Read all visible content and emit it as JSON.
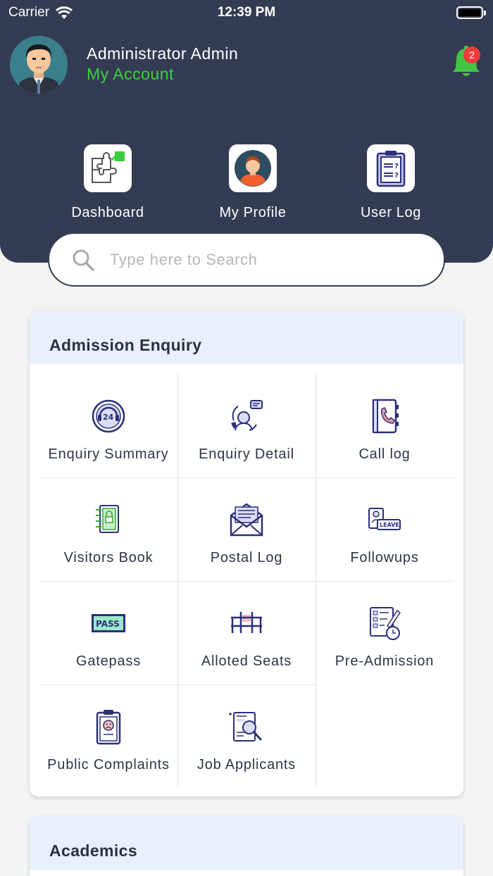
{
  "status_bar": {
    "carrier": "Carrier",
    "time": "12:39 PM"
  },
  "user": {
    "name": "Administrator Admin",
    "account_link": "My Account"
  },
  "notifications": {
    "count": "2",
    "icon": "bell-icon"
  },
  "quick_actions": [
    {
      "label": "Dashboard",
      "icon": "dashboard-puzzle-icon"
    },
    {
      "label": "My Profile",
      "icon": "profile-avatar-icon"
    },
    {
      "label": "User Log",
      "icon": "clipboard-question-icon"
    }
  ],
  "search": {
    "placeholder": "Type here to Search",
    "value": ""
  },
  "sections": [
    {
      "title": "Admission Enquiry",
      "items": [
        {
          "label": "Enquiry Summary",
          "icon": "support-24-icon"
        },
        {
          "label": "Enquiry Detail",
          "icon": "call-agent-icon"
        },
        {
          "label": "Call log",
          "icon": "phone-book-icon"
        },
        {
          "label": "Visitors Book",
          "icon": "visitor-book-icon"
        },
        {
          "label": "Postal Log",
          "icon": "envelope-icon"
        },
        {
          "label": "Followups",
          "icon": "leave-badge-icon"
        },
        {
          "label": "Gatepass",
          "icon": "pass-ticket-icon"
        },
        {
          "label": "Alloted Seats",
          "icon": "seats-icon"
        },
        {
          "label": "Pre-Admission",
          "icon": "form-clock-icon"
        },
        {
          "label": "Public Complaints",
          "icon": "complaint-clipboard-icon"
        },
        {
          "label": "Job Applicants",
          "icon": "resume-search-icon"
        }
      ]
    },
    {
      "title": "Academics"
    }
  ],
  "colors": {
    "header_bg": "#333c52",
    "accent_green": "#3bd13b",
    "badge_red": "#ee3c3c",
    "icon_navy": "#2b2f7a",
    "card_header_bg": "#e8f0fb"
  }
}
